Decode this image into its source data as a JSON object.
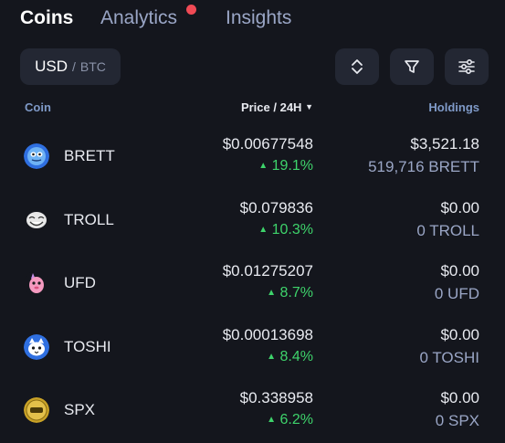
{
  "tabs": {
    "coins": "Coins",
    "analytics": "Analytics",
    "insights": "Insights"
  },
  "currency": {
    "active": "USD",
    "separator": "/",
    "inactive": "BTC"
  },
  "icons": {
    "sort": "sort-updown-icon",
    "filter": "filter-icon",
    "settings": "sliders-icon"
  },
  "columns": {
    "coin": "Coin",
    "price": "Price / 24H",
    "holdings": "Holdings"
  },
  "colors": {
    "background": "#14161d",
    "positive": "#3ed36b",
    "notification": "#f04a55"
  },
  "coins": [
    {
      "name": "BRETT",
      "price": "$0.00677548",
      "change": "19.1%",
      "holding_value": "$3,521.18",
      "holding_amount": "519,716 BRETT",
      "icon": "brett-icon"
    },
    {
      "name": "TROLL",
      "price": "$0.079836",
      "change": "10.3%",
      "holding_value": "$0.00",
      "holding_amount": "0 TROLL",
      "icon": "troll-icon"
    },
    {
      "name": "UFD",
      "price": "$0.01275207",
      "change": "8.7%",
      "holding_value": "$0.00",
      "holding_amount": "0 UFD",
      "icon": "ufd-icon"
    },
    {
      "name": "TOSHI",
      "price": "$0.00013698",
      "change": "8.4%",
      "holding_value": "$0.00",
      "holding_amount": "0 TOSHI",
      "icon": "toshi-icon"
    },
    {
      "name": "SPX",
      "price": "$0.338958",
      "change": "6.2%",
      "holding_value": "$0.00",
      "holding_amount": "0 SPX",
      "icon": "spx-icon"
    }
  ]
}
